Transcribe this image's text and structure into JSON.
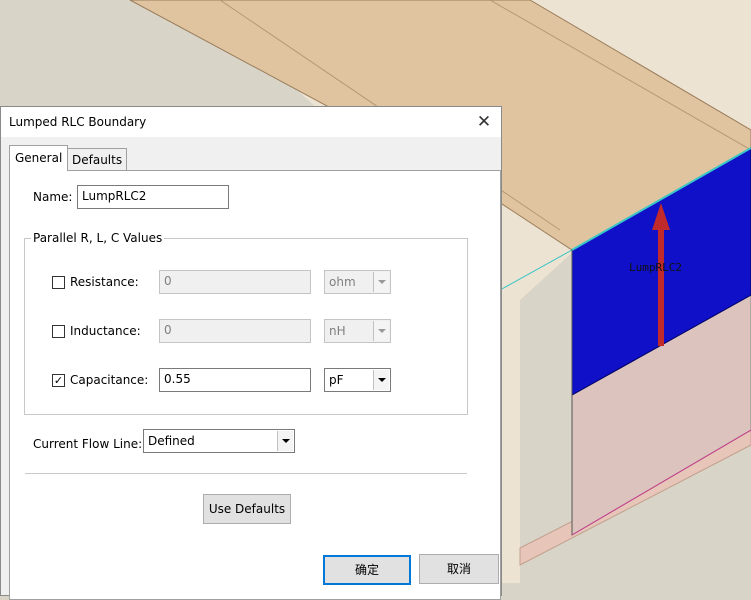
{
  "model_view": {
    "port_label": "LumpRLC2"
  },
  "dialog": {
    "title": "Lumped RLC Boundary",
    "close_glyph": "✕",
    "tabs": [
      {
        "label": "General",
        "active": true
      },
      {
        "label": "Defaults",
        "active": false
      }
    ],
    "name_label": "Name:",
    "name_value": "LumpRLC2",
    "group_title": "Parallel R, L, C Values",
    "rows": [
      {
        "label": "Resistance:",
        "checked": false,
        "check_glyph": "",
        "value": "0",
        "unit": "ohm",
        "enabled": false
      },
      {
        "label": "Inductance:",
        "checked": false,
        "check_glyph": "",
        "value": "0",
        "unit": "nH",
        "enabled": false
      },
      {
        "label": "Capacitance:",
        "checked": true,
        "check_glyph": "✓",
        "value": "0.55",
        "unit": "pF",
        "enabled": true
      }
    ],
    "flow_label": "Current Flow Line:",
    "flow_value": "Defined",
    "use_defaults_label": "Use Defaults",
    "ok_label": "确定",
    "cancel_label": "取消"
  },
  "colors": {
    "port_blue": "#1010c8",
    "arrow_red": "#c02a2a",
    "substrate_tan": "#e0c4a0",
    "ok_border": "#0078d7"
  },
  "icons": {
    "close": "close-icon",
    "dropdown": "chevron-down-icon",
    "check": "checkmark-icon"
  }
}
